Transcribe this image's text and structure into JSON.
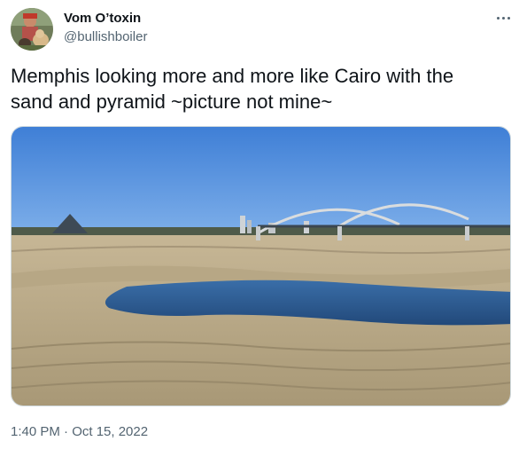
{
  "author": {
    "display_name": "Vom O’toxin",
    "handle": "@bullishboiler",
    "avatar": "user-avatar-photo"
  },
  "menu": {
    "icon": "more-dots-icon"
  },
  "tweet": {
    "text": "Memphis looking more and more like Cairo with the\nsand and pyramid ~picture not mine~",
    "timestamp": "1:40 PM · Oct 15, 2022"
  },
  "media": {
    "description_icon": "photo",
    "colors": {
      "sky": "#4a86d9",
      "sand": "#b8a98c",
      "water": "#2c5e9c"
    }
  }
}
